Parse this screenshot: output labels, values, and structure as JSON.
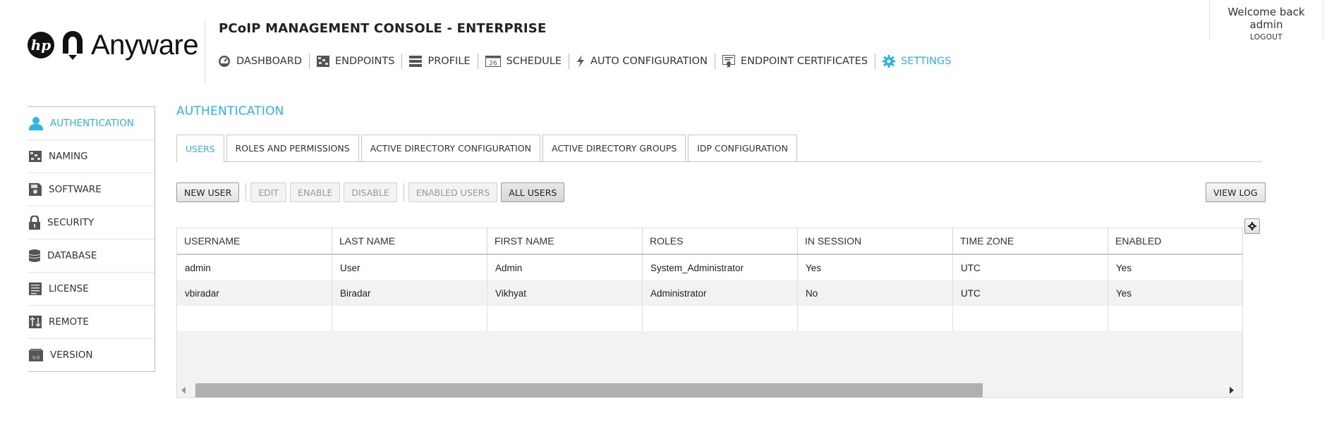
{
  "brand": {
    "hp_mark": "hp",
    "name": "Anyware"
  },
  "app": {
    "title": "PCoIP MANAGEMENT CONSOLE - ENTERPRISE"
  },
  "user": {
    "welcome": "Welcome back admin",
    "logout": "LOGOUT"
  },
  "topnav": [
    {
      "label": "DASHBOARD",
      "icon": "dashboard-icon"
    },
    {
      "label": "ENDPOINTS",
      "icon": "endpoints-icon"
    },
    {
      "label": "PROFILE",
      "icon": "profile-icon"
    },
    {
      "label": "SCHEDULE",
      "icon": "calendar-icon"
    },
    {
      "label": "AUTO CONFIGURATION",
      "icon": "lightning-icon"
    },
    {
      "label": "ENDPOINT CERTIFICATES",
      "icon": "certificate-icon"
    },
    {
      "label": "SETTINGS",
      "icon": "gear-icon",
      "active": true
    }
  ],
  "schedule_icon_text": "26",
  "sidebar": [
    {
      "label": "AUTHENTICATION",
      "icon": "user-icon",
      "active": true
    },
    {
      "label": "NAMING",
      "icon": "naming-icon"
    },
    {
      "label": "SOFTWARE",
      "icon": "software-icon"
    },
    {
      "label": "SECURITY",
      "icon": "lock-icon"
    },
    {
      "label": "DATABASE",
      "icon": "database-icon"
    },
    {
      "label": "LICENSE",
      "icon": "license-icon"
    },
    {
      "label": "REMOTE",
      "icon": "remote-icon"
    },
    {
      "label": "VERSION",
      "icon": "version-icon"
    }
  ],
  "version_icon_text": "V.0",
  "section": {
    "title": "AUTHENTICATION"
  },
  "tabs": [
    {
      "label": "USERS",
      "active": true
    },
    {
      "label": "ROLES AND PERMISSIONS"
    },
    {
      "label": "ACTIVE DIRECTORY CONFIGURATION"
    },
    {
      "label": "ACTIVE DIRECTORY GROUPS"
    },
    {
      "label": "IDP CONFIGURATION"
    }
  ],
  "toolbar": {
    "new_user": "NEW USER",
    "edit": "EDIT",
    "enable": "ENABLE",
    "disable": "DISABLE",
    "enabled_users": "ENABLED USERS",
    "all_users": "ALL USERS",
    "view_log": "VIEW LOG"
  },
  "grid": {
    "columns": [
      "USERNAME",
      "LAST NAME",
      "FIRST NAME",
      "ROLES",
      "IN SESSION",
      "TIME ZONE",
      "ENABLED"
    ],
    "rows": [
      [
        "admin",
        "User",
        "Admin",
        "System_Administrator",
        "Yes",
        "UTC",
        "Yes"
      ],
      [
        "vbiradar",
        "Biradar",
        "Vikhyat",
        "Administrator",
        "No",
        "UTC",
        "Yes"
      ]
    ]
  },
  "colors": {
    "accent": "#2fb4e0",
    "text": "#333333",
    "border": "#c6c6c6"
  }
}
